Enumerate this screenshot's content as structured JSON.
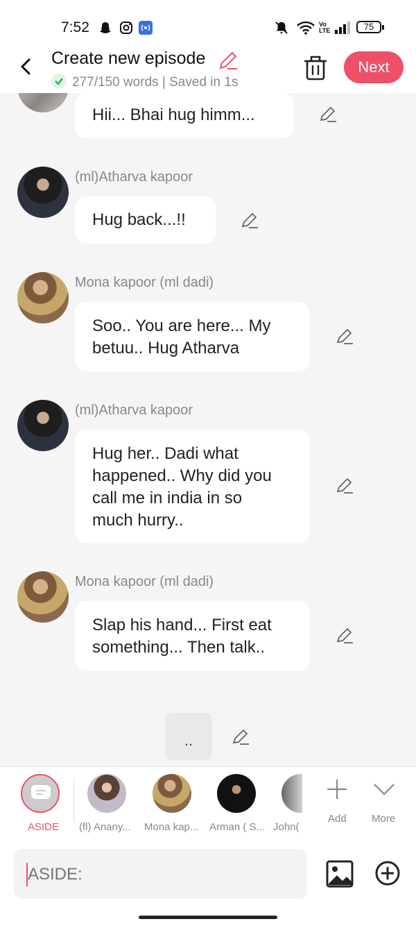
{
  "status": {
    "time": "7:52",
    "battery": "75",
    "net": "Vo LTE"
  },
  "header": {
    "title": "Create new episode",
    "subtitle": "277/150 words | Saved in 1s",
    "next_label": "Next"
  },
  "messages": [
    {
      "text": "Hii... Bhai hug himm..."
    },
    {
      "speaker": "(ml)Atharva kapoor",
      "text": "Hug back...!!"
    },
    {
      "speaker": "Mona kapoor (ml dadi)",
      "line1": "Soo.. You are here... My",
      "line2": "betuu.. Hug Atharva"
    },
    {
      "speaker": "(ml)Atharva kapoor",
      "line1": "Hug her.. Dadi what",
      "line2": "happened.. Why did you",
      "line3": "call me in india in so",
      "line4": "much hurry.."
    },
    {
      "speaker": "Mona kapoor (ml dadi)",
      "line1": "Slap his hand... First eat",
      "line2": "something... Then talk.."
    },
    {
      "text": ".."
    }
  ],
  "cast": [
    {
      "label": "ASIDE"
    },
    {
      "label": "(fl) Anany..."
    },
    {
      "label": "Mona kap..."
    },
    {
      "label": "Arman ( S..."
    },
    {
      "label": "John("
    },
    {
      "label": "Add"
    },
    {
      "label": "More"
    }
  ],
  "input": {
    "placeholder": "ASIDE:"
  },
  "colors": {
    "accent": "#ef5068",
    "bg": "#f5f5f5"
  }
}
